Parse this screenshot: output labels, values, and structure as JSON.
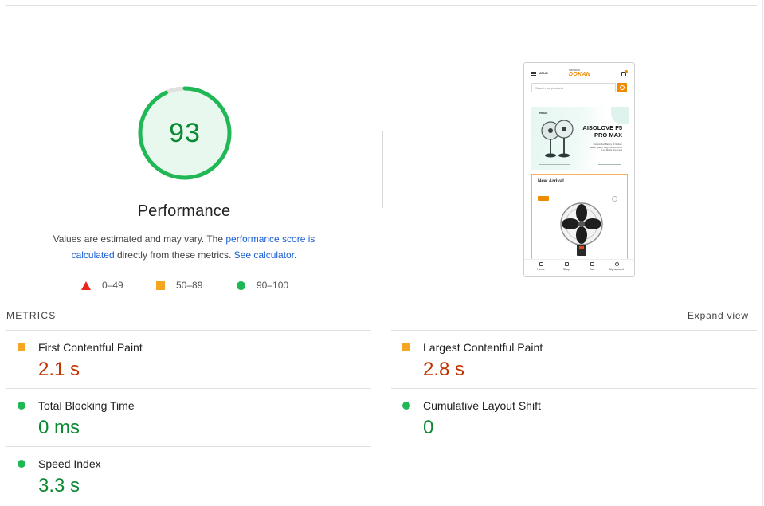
{
  "score": {
    "value": "93",
    "fraction": 0.93,
    "label": "Performance",
    "color_ring": "#1fb855",
    "color_fill": "#e9f8ee",
    "color_text": "#0a8a32"
  },
  "note": {
    "prefix": "Values are estimated and may vary. The ",
    "link1": "performance score is calculated",
    "middle": " directly from these metrics. ",
    "link2": "See calculator",
    "suffix": "."
  },
  "legend": {
    "fail": "0–49",
    "average": "50–89",
    "pass": "90–100"
  },
  "screenshot": {
    "menu": "MENU",
    "logo_top": "Fantastic",
    "logo_main": "DOKAN",
    "search_placeholder": "Search for products",
    "banner_tag": "IHEUM",
    "banner_title": "AISOLOVE F5 PRO MAX",
    "banner_sub": "Outdoor Fan Battery, 3 Outdoor Blade, Speed, Height Adjustment + Low Ripple Movement",
    "card_title": "New Arrival",
    "tabs": [
      "Home",
      "Shop",
      "Cart",
      "My account"
    ]
  },
  "metrics": {
    "heading": "METRICS",
    "expand": "Expand view",
    "items": [
      {
        "name": "First Contentful Paint",
        "value": "2.1 s",
        "rating": "average"
      },
      {
        "name": "Largest Contentful Paint",
        "value": "2.8 s",
        "rating": "average"
      },
      {
        "name": "Total Blocking Time",
        "value": "0 ms",
        "rating": "pass"
      },
      {
        "name": "Cumulative Layout Shift",
        "value": "0",
        "rating": "pass"
      },
      {
        "name": "Speed Index",
        "value": "3.3 s",
        "rating": "pass"
      }
    ]
  }
}
